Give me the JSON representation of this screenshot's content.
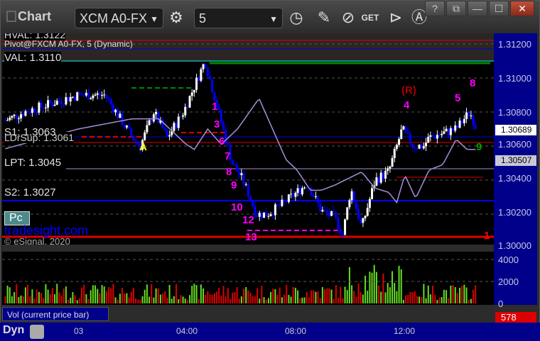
{
  "window": {
    "title": "Chart",
    "symbol": "XCM A0-FX",
    "interval": "5",
    "buttons": [
      "help",
      "restore-menu",
      "minimize",
      "maximize",
      "close"
    ],
    "help_label": "?",
    "close_label": "✕"
  },
  "toolbar": {
    "icons": [
      "settings-icon",
      "clock-icon",
      "pencil-icon",
      "study-icon",
      "get-icon",
      "play-icon",
      "alert-icon"
    ],
    "get_label": "GET"
  },
  "overlay": {
    "hval": "HVAL: 1.3122",
    "study": "Pivot@FXCM A0-FX, 5 (Dynamic)",
    "val": "VAL: 1.3110",
    "s1": "S1: 1.3063",
    "ldr": "LDrSup: 1.3061",
    "lpt": "LPT: 1.3045",
    "s2": "S2: 1.3027",
    "pc": "Pc",
    "watermark": "tradesight.com",
    "copyright": "© eSignal, 2020"
  },
  "price_axis": {
    "ticks": [
      "1.31200",
      "1.31000",
      "1.30800",
      "1.30600",
      "1.30400",
      "1.30200",
      "1.30000"
    ],
    "last": "1.30689",
    "ma": "1.30507"
  },
  "volume": {
    "label": "Vol (current price bar)",
    "ticks": [
      "4000",
      "2000",
      "0"
    ],
    "last": "578"
  },
  "time_axis": {
    "ticks": [
      "03",
      "04:00",
      "08:00",
      "12:00"
    ],
    "mode": "Dyn"
  },
  "chart_data": {
    "type": "candlestick",
    "x_unit": "hours since 03 00:00",
    "path": [
      [
        -2.7,
        1.3075
      ],
      [
        -2,
        1.308
      ],
      [
        -1,
        1.3085
      ],
      [
        0,
        1.309
      ],
      [
        1,
        1.309
      ],
      [
        2,
        1.3065
      ],
      [
        2.3,
        1.306
      ],
      [
        2.8,
        1.308
      ],
      [
        3.3,
        1.3065
      ],
      [
        3.9,
        1.308
      ],
      [
        4.7,
        1.311
      ],
      [
        5.2,
        1.308
      ],
      [
        5.7,
        1.305
      ],
      [
        6.1,
        1.304
      ],
      [
        6.6,
        1.302
      ],
      [
        7,
        1.302
      ],
      [
        7.5,
        1.3025
      ],
      [
        8.5,
        1.3038
      ],
      [
        9,
        1.3022
      ],
      [
        9.5,
        1.3018
      ],
      [
        9.8,
        1.3008
      ],
      [
        10.1,
        1.3035
      ],
      [
        10.5,
        1.3012
      ],
      [
        11,
        1.304
      ],
      [
        11.5,
        1.3045
      ],
      [
        12,
        1.307
      ],
      [
        12.4,
        1.306
      ],
      [
        12.8,
        1.306
      ],
      [
        13,
        1.3065
      ],
      [
        14,
        1.307
      ],
      [
        14.5,
        1.308
      ],
      [
        14.8,
        1.30689
      ]
    ],
    "annotations": [
      {
        "t": "A",
        "c": "#ffff00"
      },
      {
        "t": "(R)",
        "c": "#aa0000"
      },
      {
        "t": "1",
        "c": "#ff00ff"
      },
      {
        "t": "3",
        "c": "#ff00ff"
      },
      {
        "t": "6",
        "c": "#ff00ff"
      },
      {
        "t": "7",
        "c": "#ff00ff"
      },
      {
        "t": "8",
        "c": "#ff00ff"
      },
      {
        "t": "9",
        "c": "#ff00ff"
      },
      {
        "t": "10",
        "c": "#ff00ff"
      },
      {
        "t": "12",
        "c": "#ff00ff"
      },
      {
        "t": "13",
        "c": "#ff00ff"
      },
      {
        "t": "4",
        "c": "#ff00ff"
      },
      {
        "t": "5",
        "c": "#ff00ff"
      },
      {
        "t": "8",
        "c": "#ff00ff"
      },
      {
        "t": "1",
        "c": "#ff0000"
      },
      {
        "t": "9",
        "c": "#00a000"
      }
    ],
    "colors": {
      "up": "#ffffff",
      "down": "#0000ff",
      "vol_up": "#66dd22",
      "vol_down": "#dd0000",
      "ma": "#a58fd8"
    }
  }
}
